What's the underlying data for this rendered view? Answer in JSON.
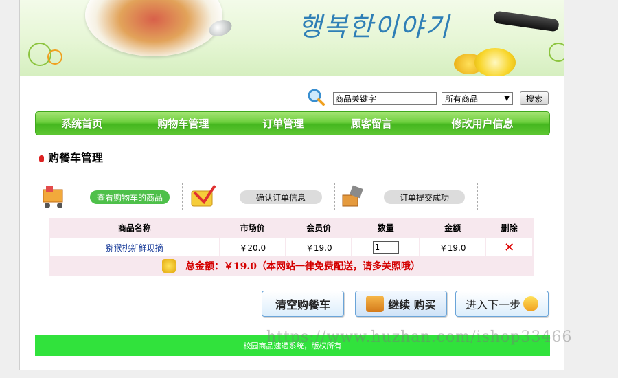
{
  "search": {
    "input_value": "商品关键字",
    "category_selected": "所有商品",
    "button_label": "搜索"
  },
  "nav": {
    "items": [
      {
        "label": "系统首页"
      },
      {
        "label": "购物车管理"
      },
      {
        "label": "订单管理"
      },
      {
        "label": "顾客留言"
      },
      {
        "label": "修改用户信息"
      }
    ]
  },
  "page": {
    "section_title": "购餐车管理"
  },
  "steps": [
    {
      "label": "查看购物车的商品",
      "active": true
    },
    {
      "label": "确认订单信息",
      "active": false
    },
    {
      "label": "订单提交成功",
      "active": false
    }
  ],
  "cart": {
    "headers": [
      "商品名称",
      "市场价",
      "会员价",
      "数量",
      "金额",
      "删除"
    ],
    "rows": [
      {
        "name": "猕猴桃新鲜现摘",
        "market_price": "￥20.0",
        "member_price": "￥19.0",
        "quantity": "1",
        "amount": "￥19.0"
      }
    ],
    "total_text": "总金额：￥19.0（本网站一律免费配送，请多关照哦）"
  },
  "actions": {
    "clear_label": "清空购餐车",
    "continue_label": "继续 购买",
    "next_label": "进入下一步"
  },
  "footer": {
    "text": "校园商品速递系统，版权所有"
  },
  "watermark": "https://www.huzhan.com/ishop33466",
  "colors": {
    "nav_green": "#5dc632",
    "footer_green": "#31e23c",
    "total_red": "#d40000",
    "link_blue": "#1a3d9a",
    "table_bg": "#f7e8ee"
  }
}
